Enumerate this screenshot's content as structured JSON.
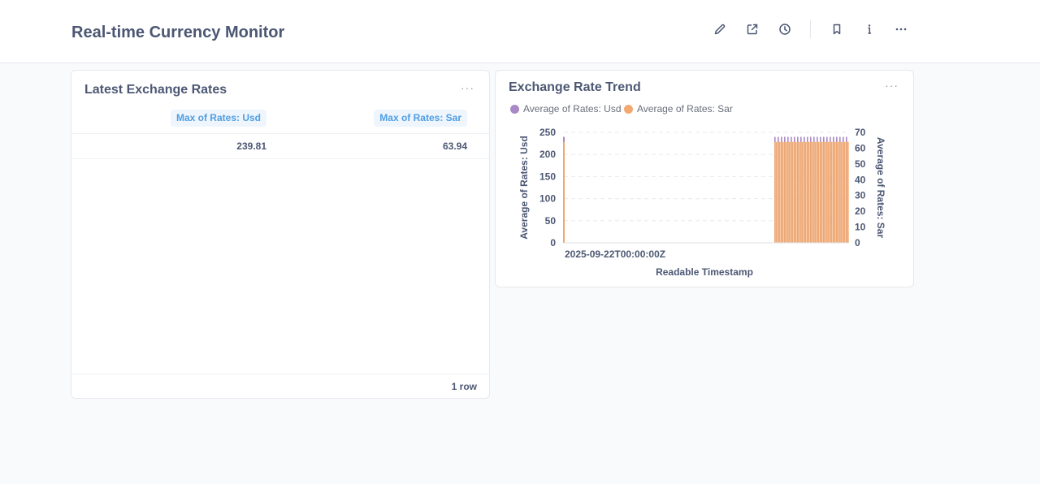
{
  "dashboard": {
    "title": "Real-time Currency Monitor",
    "toolbar": [
      {
        "icon": "pencil-icon",
        "name": "edit-button"
      },
      {
        "icon": "external-share-icon",
        "name": "share-button"
      },
      {
        "icon": "clock-icon",
        "name": "history-button"
      },
      {
        "icon": "bookmark-icon",
        "name": "bookmark-button"
      },
      {
        "icon": "info-icon",
        "name": "info-button"
      },
      {
        "icon": "more-icon",
        "name": "more-button"
      }
    ]
  },
  "table_card": {
    "title": "Latest Exchange Rates",
    "menu": "···",
    "columns": [
      "Max of Rates: Usd",
      "Max of Rates: Sar"
    ],
    "rows": [
      [
        "239.81",
        "63.94"
      ]
    ],
    "row_count": "1 row"
  },
  "chart_card": {
    "title": "Exchange Rate Trend",
    "menu": "···",
    "legend": [
      {
        "label": "Average of Rates: Usd",
        "color": "#a989c5"
      },
      {
        "label": "Average of Rates: Sar",
        "color": "#f2a86f"
      }
    ]
  },
  "chart_data": {
    "type": "bar",
    "x": [
      "2025-09-22T00:00:00Z"
    ],
    "xlabel": "Readable Timestamp",
    "ylabel": "Average of Rates: Usd",
    "y2label": "Average of Rates: Sar",
    "ylim": [
      0,
      250
    ],
    "y2lim": [
      0,
      70
    ],
    "yticks": [
      "0",
      "50",
      "100",
      "150",
      "200",
      "250"
    ],
    "y2ticks": [
      "0",
      "10",
      "20",
      "30",
      "40",
      "50",
      "60",
      "70"
    ],
    "grid": true,
    "legend_position": "top-left",
    "series": [
      {
        "name": "Average of Rates: Usd",
        "color": "#a989c5",
        "axis": "left",
        "start_value": 239.81,
        "end_value": 239.81
      },
      {
        "name": "Average of Rates: Sar",
        "color": "#f2a86f",
        "axis": "right",
        "start_value": 63.94,
        "end_value": 63.94
      }
    ]
  }
}
